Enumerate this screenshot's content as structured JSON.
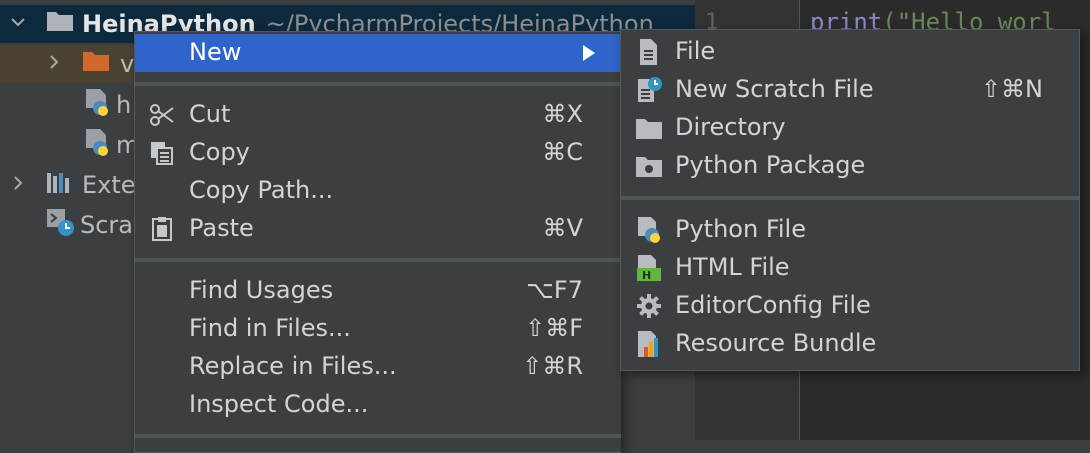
{
  "tree": {
    "project_name": "HeinaPython",
    "project_path": "~/PycharmProjects/HeinaPython",
    "items": [
      {
        "label": "v",
        "icon": "folder-icon"
      },
      {
        "label": "h",
        "icon": "python-file-icon"
      },
      {
        "label": "m",
        "icon": "python-file-icon"
      },
      {
        "label": "Exte",
        "icon": "library-icon"
      },
      {
        "label": "Scra",
        "icon": "scratch-icon"
      }
    ]
  },
  "editor": {
    "line_number": "1",
    "code_fn": "print",
    "code_rest": "(\"Hello worl"
  },
  "menu": {
    "new_label": "New",
    "cut": {
      "label": "Cut",
      "shortcut": "⌘X"
    },
    "copy": {
      "label": "Copy",
      "shortcut": "⌘C"
    },
    "copy_path": {
      "label": "Copy Path..."
    },
    "paste": {
      "label": "Paste",
      "shortcut": "⌘V"
    },
    "find_usages": {
      "label": "Find Usages",
      "shortcut": "⌥F7"
    },
    "find_in_files": {
      "label": "Find in Files...",
      "shortcut": "⇧⌘F"
    },
    "replace_in_files": {
      "label": "Replace in Files...",
      "shortcut": "⇧⌘R"
    },
    "inspect_code": {
      "label": "Inspect Code..."
    }
  },
  "submenu": {
    "file": "File",
    "scratch": {
      "label": "New Scratch File",
      "shortcut": "⇧⌘N"
    },
    "directory": "Directory",
    "python_package": "Python Package",
    "python_file": "Python File",
    "html_file": "HTML File",
    "editorconfig": "EditorConfig File",
    "resource_bundle": "Resource Bundle"
  },
  "colors": {
    "highlight": "#2f65ca",
    "menu_bg": "#3c3f41",
    "editor_bg": "#2b2b2b"
  }
}
